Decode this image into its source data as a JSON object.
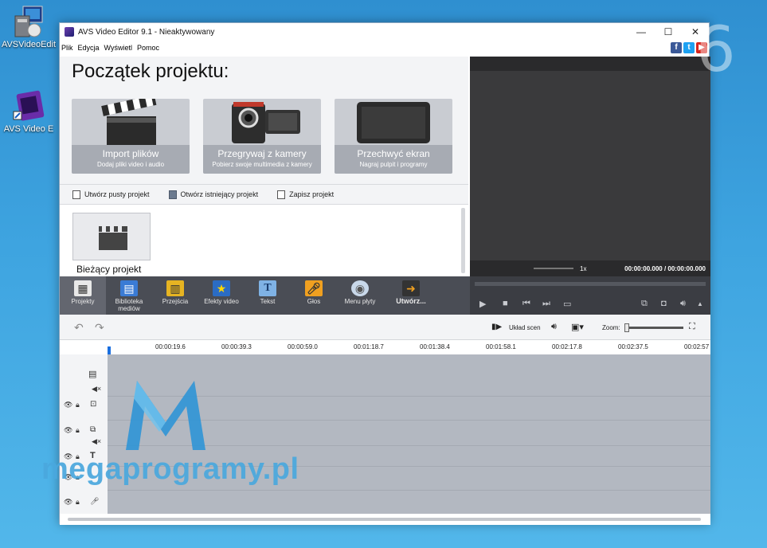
{
  "desktop": {
    "icons": [
      {
        "label": "AVSVideoEdit"
      },
      {
        "label": "AVS Video E"
      }
    ]
  },
  "window": {
    "title": "AVS Video Editor 9.1 - Nieaktywowany",
    "controls": [
      "—",
      "☐",
      "✕"
    ]
  },
  "menu": [
    "Plik",
    "Edycja",
    "Wyświetl",
    "Pomoc"
  ],
  "start": {
    "title": "Początek projektu:",
    "tiles": [
      {
        "title": "Import plików",
        "subtitle": "Dodaj pliki video i audio"
      },
      {
        "title": "Przegrywaj z kamery",
        "subtitle": "Pobierz swoje multimedia z kamery"
      },
      {
        "title": "Przechwyć ekran",
        "subtitle": "Nagraj pulpit i programy"
      }
    ],
    "actions": [
      "Utwórz pusty projekt",
      "Otwórz istniejący projekt",
      "Zapisz projekt"
    ],
    "recent_label": "Bieżący projekt"
  },
  "preview": {
    "speed": "1x",
    "time": "00:00:00.000 / 00:00:00.000"
  },
  "toolbar": [
    {
      "label": "Projekty"
    },
    {
      "label": "Biblioteka mediów"
    },
    {
      "label": "Przejścia"
    },
    {
      "label": "Efekty video"
    },
    {
      "label": "Tekst"
    },
    {
      "label": "Głos"
    },
    {
      "label": "Menu płyty"
    },
    {
      "label": "Utwórz..."
    }
  ],
  "timeline": {
    "layout_label": "Układ scen",
    "zoom_label": "Zoom:",
    "ruler": [
      "00:00:19.6",
      "00:00:39.3",
      "00:00:59.0",
      "00:01:18.7",
      "00:01:38.4",
      "00:01:58.1",
      "00:02:17.8",
      "00:02:37.5",
      "00:02:57"
    ]
  },
  "watermark": {
    "text": "megaprogramy.pl",
    "corner": "6"
  }
}
